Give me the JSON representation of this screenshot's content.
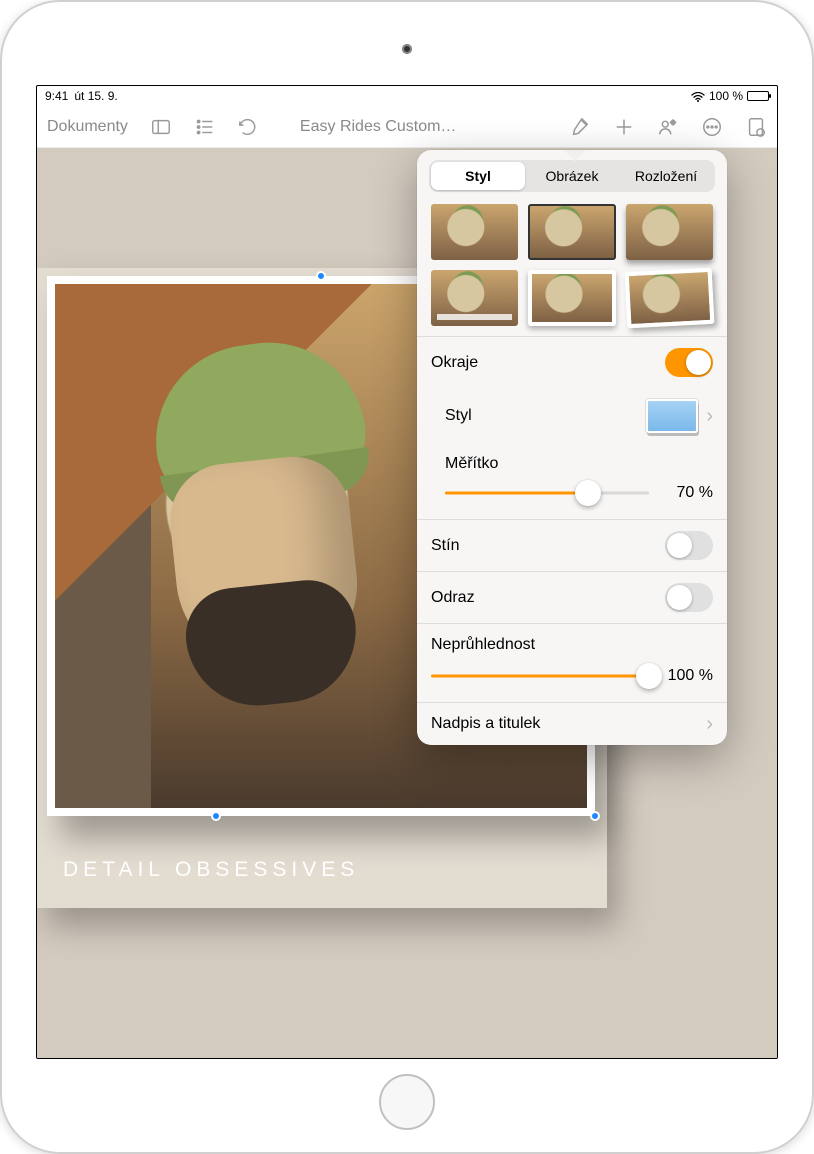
{
  "status": {
    "time": "9:41",
    "date": "út 15. 9.",
    "battery_pct": "100 %"
  },
  "toolbar": {
    "back_label": "Dokumenty",
    "title": "Easy Rides Custom…"
  },
  "document": {
    "caption": "DETAIL OBSESSIVES"
  },
  "popover": {
    "tabs": {
      "style": "Styl",
      "image": "Obrázek",
      "layout": "Rozložení"
    },
    "border_label": "Okraje",
    "border_on": true,
    "style_label": "Styl",
    "scale_label": "Měřítko",
    "scale_pct": "70 %",
    "scale_value": 70,
    "shadow_label": "Stín",
    "shadow_on": false,
    "reflect_label": "Odraz",
    "reflect_on": false,
    "opacity_label": "Neprůhlednost",
    "opacity_pct": "100 %",
    "opacity_value": 100,
    "title_caption_label": "Nadpis a titulek"
  }
}
